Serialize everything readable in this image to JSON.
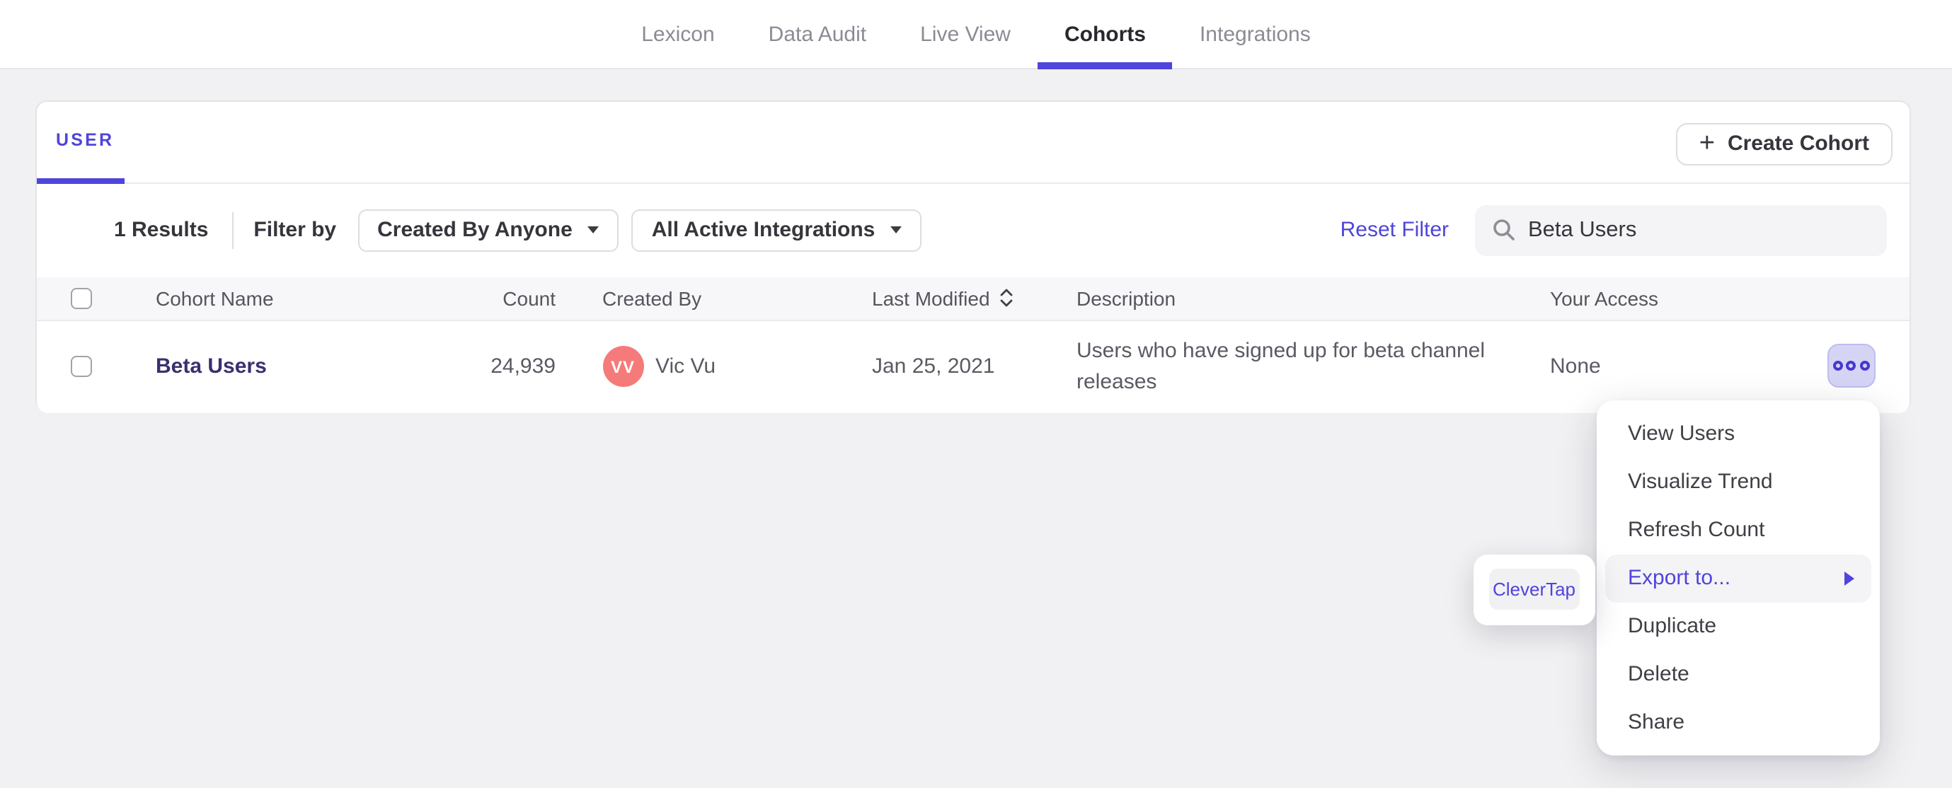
{
  "nav": {
    "items": [
      {
        "label": "Lexicon",
        "active": false
      },
      {
        "label": "Data Audit",
        "active": false
      },
      {
        "label": "Live View",
        "active": false
      },
      {
        "label": "Cohorts",
        "active": true
      },
      {
        "label": "Integrations",
        "active": false
      }
    ]
  },
  "panel": {
    "tab_label": "USER",
    "create_button": {
      "icon": "+",
      "label": "Create Cohort"
    },
    "filter_bar": {
      "results_count": "1 Results",
      "filter_by_label": "Filter by",
      "created_by_dropdown": "Created By Anyone",
      "integrations_dropdown": "All Active Integrations",
      "reset_link": "Reset Filter",
      "search": {
        "value": "Beta Users"
      }
    },
    "table": {
      "headers": {
        "name": "Cohort Name",
        "count": "Count",
        "created_by": "Created By",
        "last_modified": "Last Modified",
        "description": "Description",
        "access": "Your Access"
      },
      "rows": [
        {
          "name": "Beta Users",
          "count": "24,939",
          "creator_initials": "VV",
          "creator_name": "Vic Vu",
          "last_modified": "Jan 25, 2021",
          "description": "Users who have signed up for beta channel releases",
          "access": "None"
        }
      ]
    }
  },
  "row_menu": {
    "highlighted_item": "Export to...",
    "items": [
      {
        "label": "View Users"
      },
      {
        "label": "Visualize Trend"
      },
      {
        "label": "Refresh Count"
      },
      {
        "label": "Export to...",
        "highlighted": true,
        "has_submenu": true
      },
      {
        "label": "Duplicate"
      },
      {
        "label": "Delete"
      },
      {
        "label": "Share"
      }
    ]
  },
  "export_submenu": {
    "items": [
      {
        "label": "CleverTap"
      }
    ]
  },
  "colors": {
    "accent": "#4f44db",
    "avatar": "#f57b7b",
    "cohort_link": "#37316e",
    "menu_highlight_bg": "#f4f4f6",
    "meatball_bg": "#d6d4f4"
  }
}
